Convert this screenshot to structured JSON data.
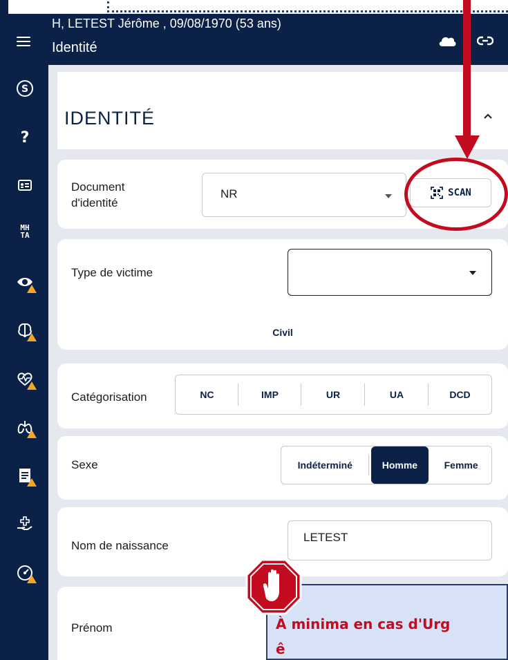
{
  "header": {
    "patient": "H, LETEST Jérôme , 09/08/1970 (53 ans)",
    "screen_title": "Identité"
  },
  "sidebar": {
    "items": [
      {
        "icon": "s-circle-icon",
        "label": "S",
        "warning": false
      },
      {
        "icon": "question-icon",
        "label": "?",
        "warning": false
      },
      {
        "icon": "id-card-icon",
        "label": "",
        "warning": false
      },
      {
        "icon": "mhta-icon",
        "label": "MH TA",
        "warning": false
      },
      {
        "icon": "eye-icon",
        "label": "",
        "warning": true
      },
      {
        "icon": "brain-icon",
        "label": "",
        "warning": true
      },
      {
        "icon": "heart-rate-icon",
        "label": "",
        "warning": true
      },
      {
        "icon": "lungs-icon",
        "label": "",
        "warning": true
      },
      {
        "icon": "document-icon",
        "label": "",
        "warning": true
      },
      {
        "icon": "hand-care-icon",
        "label": "",
        "warning": false
      },
      {
        "icon": "gauge-icon",
        "label": "",
        "warning": true
      }
    ]
  },
  "section": {
    "title": "IDENTITÉ"
  },
  "document_identite": {
    "label_line1": "Document",
    "label_line2": "d'identité",
    "value": "NR",
    "scan_label": "SCAN"
  },
  "type_victime": {
    "label": "Type de victime",
    "value": "",
    "option": "Civil"
  },
  "categorisation": {
    "label": "Catégorisation",
    "options": [
      "NC",
      "IMP",
      "UR",
      "UA",
      "DCD"
    ]
  },
  "sexe": {
    "label": "Sexe",
    "options": [
      "Indéterminé",
      "Homme",
      "Femme"
    ],
    "selected": "Homme"
  },
  "nom_naissance": {
    "label": "Nom de naissance",
    "value": "LETEST"
  },
  "prenom": {
    "label": "Prénom"
  },
  "callout": {
    "line1": "À minima en cas d'Urg",
    "line2": "ê"
  },
  "colors": {
    "navy": "#0b2148",
    "annotation_red": "#c20b1e",
    "warning": "#f5a623"
  }
}
